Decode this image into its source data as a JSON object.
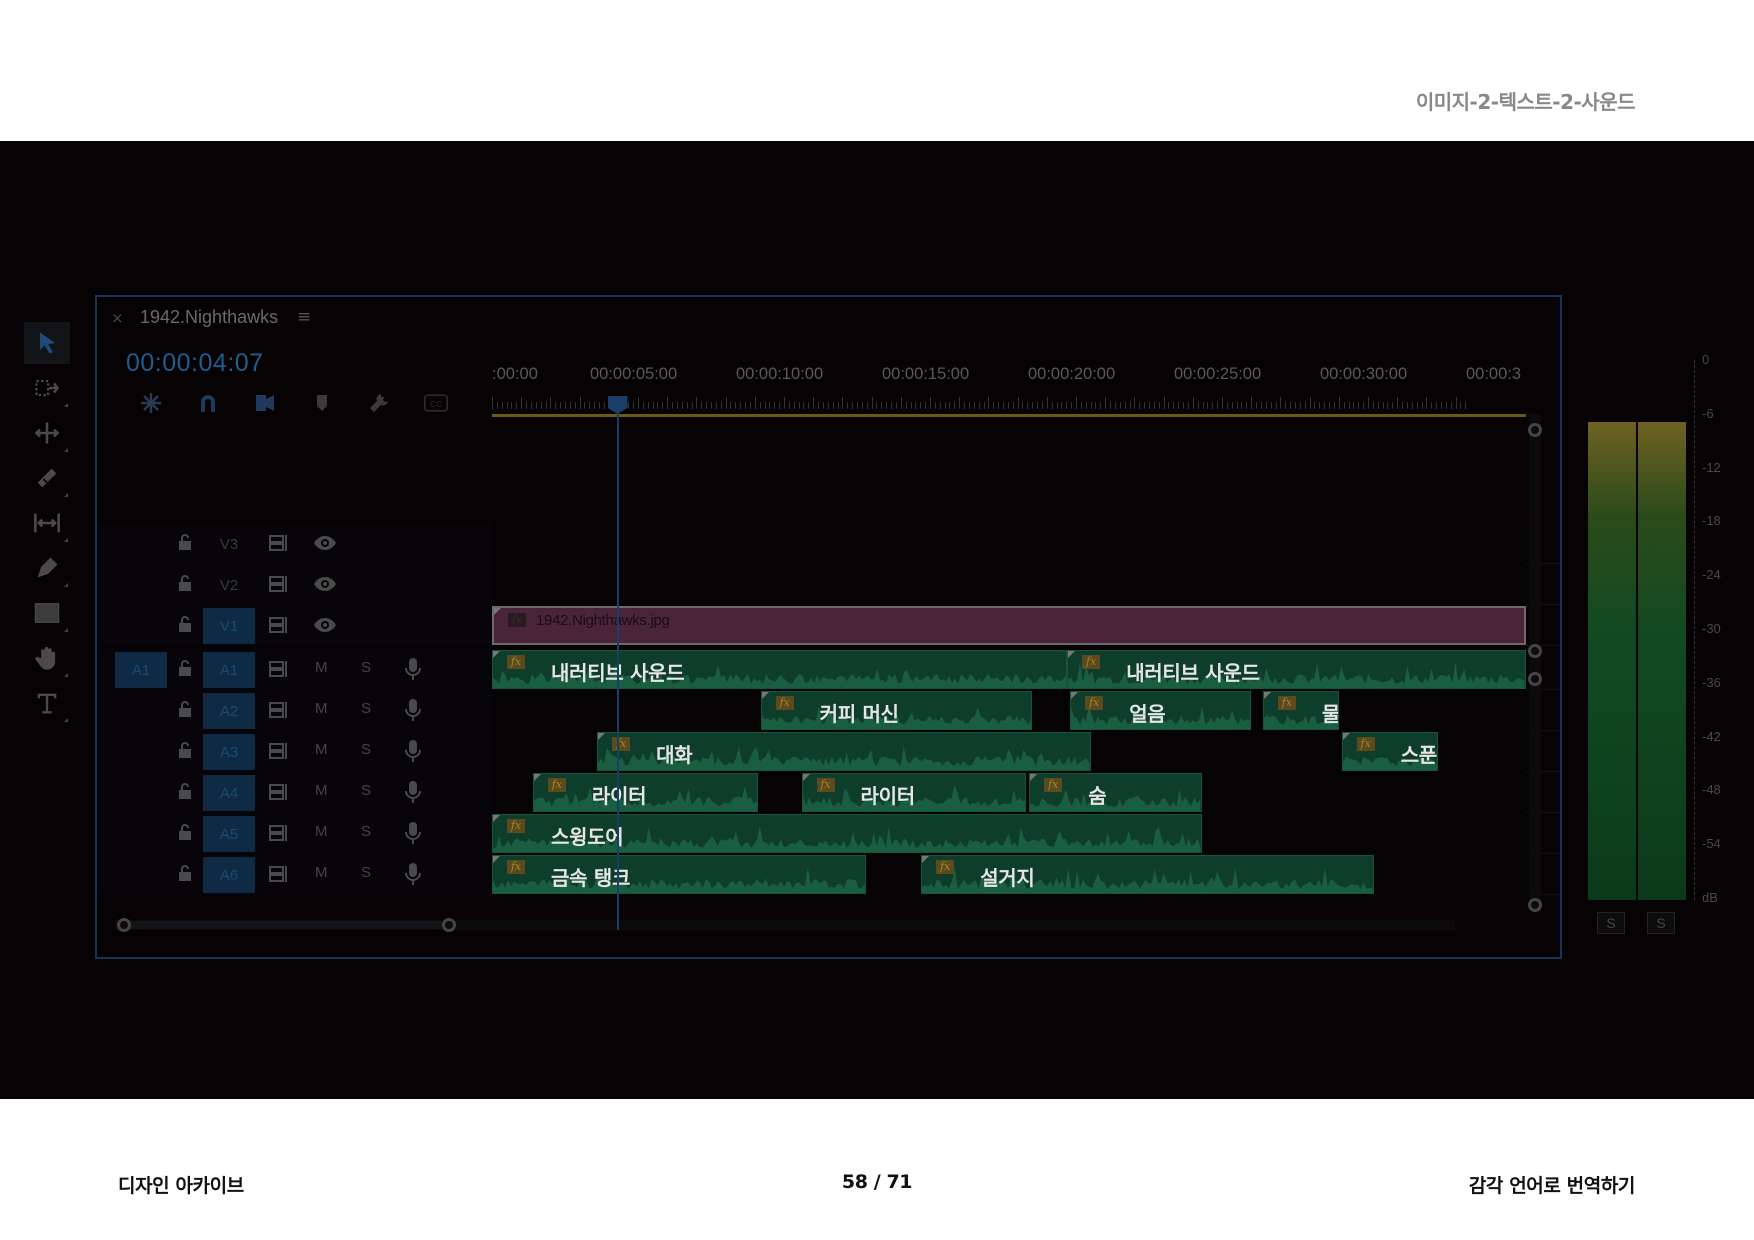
{
  "doc": {
    "section_title": "이미지-2-텍스트-2-사운드",
    "footer_left": "디자인 아카이브",
    "page_indicator": "58 / 71",
    "footer_right": "감각 언어로 번역하기"
  },
  "tools": [
    {
      "name": "selection-tool-icon",
      "active": true
    },
    {
      "name": "track-select-forward-icon"
    },
    {
      "name": "ripple-edit-icon"
    },
    {
      "name": "razor-icon"
    },
    {
      "name": "slip-icon"
    },
    {
      "name": "pen-icon"
    },
    {
      "name": "rectangle-icon"
    },
    {
      "name": "hand-icon"
    },
    {
      "name": "type-icon"
    }
  ],
  "sequence": {
    "tab_close": "×",
    "tab_title": "1942.Nighthawks",
    "tab_menu": "≡",
    "timecode": "00:00:04:07",
    "playhead_seconds": 4.3,
    "ruler_labels": [
      ":00:00",
      "00:00:05:00",
      "00:00:10:00",
      "00:00:15:00",
      "00:00:20:00",
      "00:00:25:00",
      "00:00:30:00",
      "00:00:3"
    ],
    "timeline_tools": [
      "snap-icon",
      "magnet-icon",
      "linked-selection-icon",
      "marker-icon",
      "wrench-icon",
      "captions-icon"
    ]
  },
  "tracks": [
    {
      "id": "V3",
      "type": "video",
      "target": false,
      "clips": []
    },
    {
      "id": "V2",
      "type": "video",
      "target": false,
      "clips": []
    },
    {
      "id": "V1",
      "type": "video",
      "target": true,
      "clips": [
        {
          "name": "1942.Nighthawks.jpg",
          "start": 0,
          "end": 35.4
        }
      ]
    },
    {
      "id": "A1",
      "type": "audio",
      "source": "A1",
      "target": true,
      "mute": "M",
      "solo": "S",
      "clips": [
        {
          "name": "내러티브 사운드",
          "start": 0,
          "end": 19.7
        },
        {
          "name": "내러티브 사운드",
          "start": 19.7,
          "end": 35.4
        }
      ]
    },
    {
      "id": "A2",
      "type": "audio",
      "target": true,
      "mute": "M",
      "solo": "S",
      "clips": [
        {
          "name": "커피 머신",
          "start": 9.2,
          "end": 18.5
        },
        {
          "name": "얼음",
          "start": 19.8,
          "end": 26.0
        },
        {
          "name": "물",
          "start": 26.4,
          "end": 29.0
        }
      ]
    },
    {
      "id": "A3",
      "type": "audio",
      "target": true,
      "mute": "M",
      "solo": "S",
      "clips": [
        {
          "name": "대화",
          "start": 3.6,
          "end": 20.5
        },
        {
          "name": "스푼",
          "start": 29.1,
          "end": 32.4
        }
      ]
    },
    {
      "id": "A4",
      "type": "audio",
      "target": true,
      "mute": "M",
      "solo": "S",
      "clips": [
        {
          "name": "라이터",
          "start": 1.4,
          "end": 9.1
        },
        {
          "name": "라이터",
          "start": 10.6,
          "end": 18.3
        },
        {
          "name": "숨",
          "start": 18.4,
          "end": 24.3
        }
      ]
    },
    {
      "id": "A5",
      "type": "audio",
      "target": true,
      "mute": "M",
      "solo": "S",
      "clips": [
        {
          "name": "스윙도어",
          "start": 0,
          "end": 24.3
        }
      ]
    },
    {
      "id": "A6",
      "type": "audio",
      "target": true,
      "mute": "M",
      "solo": "S",
      "clips": [
        {
          "name": "금속 탱크",
          "start": 0,
          "end": 12.8
        },
        {
          "name": "설거지",
          "start": 14.7,
          "end": 30.2
        }
      ]
    }
  ],
  "audio_meter": {
    "scale": [
      "0",
      "-6",
      "-12",
      "-18",
      "-24",
      "-30",
      "-36",
      "-42",
      "-48",
      "-54",
      "dB"
    ],
    "solo_labels": [
      "S",
      "S"
    ]
  }
}
